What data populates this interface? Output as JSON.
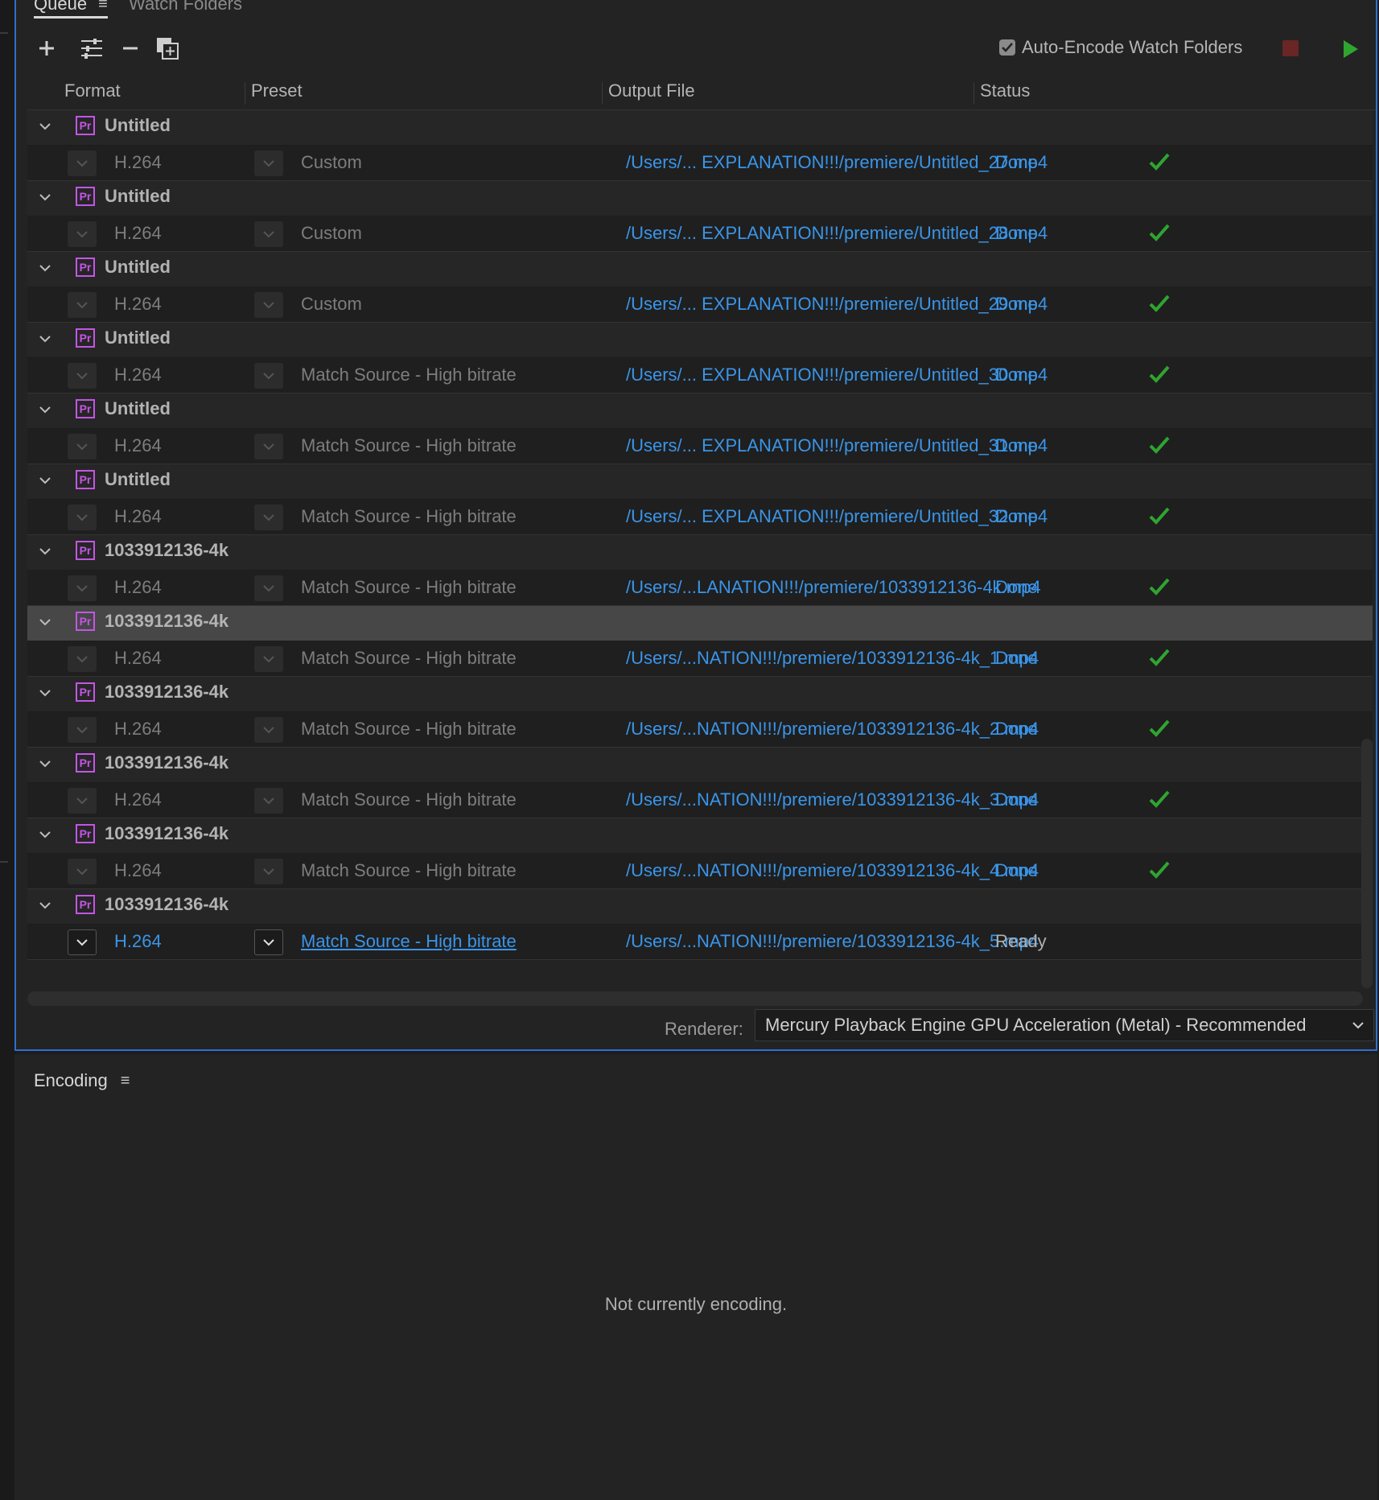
{
  "tabs": [
    {
      "label": "Queue",
      "active": true
    },
    {
      "label": "Watch Folders",
      "active": false
    }
  ],
  "toolbar": {
    "buttons": [
      {
        "name": "add-source-button",
        "icon": "plus-icon"
      },
      {
        "name": "settings-button",
        "icon": "sliders-icon"
      },
      {
        "name": "remove-button",
        "icon": "minus-icon"
      },
      {
        "name": "duplicate-button",
        "icon": "duplicate-icon"
      }
    ],
    "auto_encode_label": "Auto-Encode Watch Folders",
    "auto_encode_checked": true,
    "stop_color": "#6a2525",
    "start_color": "#2fa52f"
  },
  "columns": [
    "Format",
    "Preset",
    "Output File",
    "Status"
  ],
  "queue": [
    {
      "source": "Untitled",
      "format": "H.264",
      "preset": "Custom",
      "output": "/Users/... EXPLANATION!!!/premiere/Untitled_27.mp4",
      "status": "Done"
    },
    {
      "source": "Untitled",
      "format": "H.264",
      "preset": "Custom",
      "output": "/Users/... EXPLANATION!!!/premiere/Untitled_28.mp4",
      "status": "Done"
    },
    {
      "source": "Untitled",
      "format": "H.264",
      "preset": "Custom",
      "output": "/Users/... EXPLANATION!!!/premiere/Untitled_29.mp4",
      "status": "Done"
    },
    {
      "source": "Untitled",
      "format": "H.264",
      "preset": "Match Source - High bitrate",
      "output": "/Users/... EXPLANATION!!!/premiere/Untitled_30.mp4",
      "status": "Done"
    },
    {
      "source": "Untitled",
      "format": "H.264",
      "preset": "Match Source - High bitrate",
      "output": "/Users/... EXPLANATION!!!/premiere/Untitled_31.mp4",
      "status": "Done"
    },
    {
      "source": "Untitled",
      "format": "H.264",
      "preset": "Match Source - High bitrate",
      "output": "/Users/... EXPLANATION!!!/premiere/Untitled_32.mp4",
      "status": "Done"
    },
    {
      "source": "1033912136-4k",
      "format": "H.264",
      "preset": "Match Source - High bitrate",
      "output": "/Users/...LANATION!!!/premiere/1033912136-4k.mp4",
      "status": "Done"
    },
    {
      "source": "1033912136-4k",
      "format": "H.264",
      "preset": "Match Source - High bitrate",
      "output": "/Users/...NATION!!!/premiere/1033912136-4k_1.mp4",
      "status": "Done",
      "selected": true
    },
    {
      "source": "1033912136-4k",
      "format": "H.264",
      "preset": "Match Source - High bitrate",
      "output": "/Users/...NATION!!!/premiere/1033912136-4k_2.mp4",
      "status": "Done"
    },
    {
      "source": "1033912136-4k",
      "format": "H.264",
      "preset": "Match Source - High bitrate",
      "output": "/Users/...NATION!!!/premiere/1033912136-4k_3.mp4",
      "status": "Done"
    },
    {
      "source": "1033912136-4k",
      "format": "H.264",
      "preset": "Match Source - High bitrate",
      "output": "/Users/...NATION!!!/premiere/1033912136-4k_4.mp4",
      "status": "Done"
    },
    {
      "source": "1033912136-4k",
      "format": "H.264",
      "preset": "Match Source - High bitrate",
      "output": "/Users/...NATION!!!/premiere/1033912136-4k_5.mp4",
      "status": "Ready",
      "active": true
    }
  ],
  "renderer": {
    "label": "Renderer:",
    "value": "Mercury Playback Engine GPU Acceleration (Metal) - Recommended"
  },
  "encoding": {
    "tab_label": "Encoding",
    "message": "Not currently encoding."
  },
  "colors": {
    "accent_blue": "#3a95e9",
    "done_green": "#2fa52f",
    "premiere_purple": "#c455e6",
    "panel_focus_border": "#2f6fd0"
  }
}
